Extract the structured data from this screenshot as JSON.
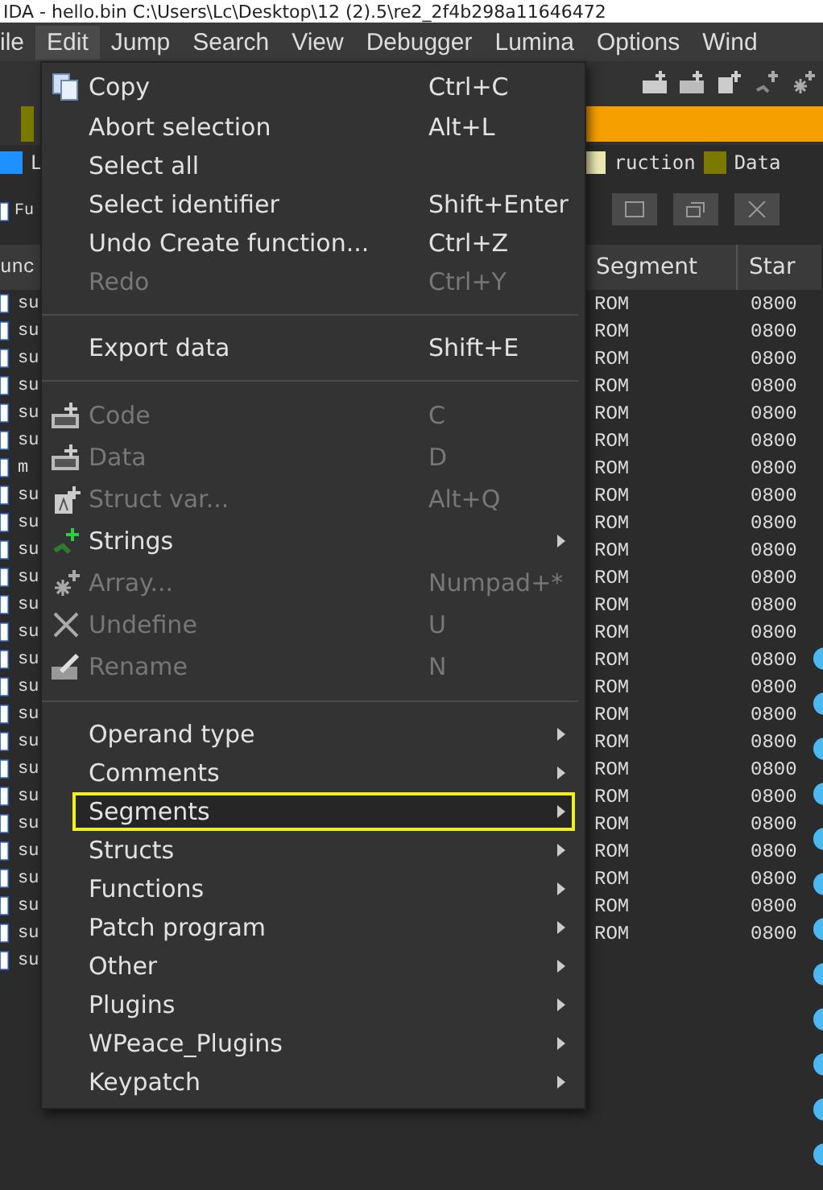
{
  "window": {
    "title": "IDA - hello.bin C:\\Users\\Lc\\Desktop\\12 (2).5\\re2_2f4b298a11646472"
  },
  "menubar": [
    {
      "label": "ile",
      "selected": false
    },
    {
      "label": "Edit",
      "selected": true
    },
    {
      "label": "Jump",
      "selected": false
    },
    {
      "label": "Search",
      "selected": false
    },
    {
      "label": "View",
      "selected": false
    },
    {
      "label": "Debugger",
      "selected": false
    },
    {
      "label": "Lumina",
      "selected": false
    },
    {
      "label": "Options",
      "selected": false
    },
    {
      "label": "Wind",
      "selected": false
    }
  ],
  "legend": [
    {
      "label": "L",
      "color": "#1e90ff"
    },
    {
      "label": "ruction",
      "color": "#e8e8b0"
    },
    {
      "label": "Data",
      "color": "#7a7a00"
    }
  ],
  "functions_panel": {
    "tab": "Fu",
    "column": "unc",
    "rows": [
      "su",
      "su",
      "su",
      "su",
      "su",
      "su",
      "m",
      "su",
      "su",
      "su",
      "su",
      "su",
      "su",
      "su",
      "su",
      "su",
      "su",
      "su",
      "su",
      "su",
      "su",
      "su",
      "su",
      "su",
      "su"
    ]
  },
  "segments_table": {
    "columns": [
      "Segment",
      "Star"
    ],
    "rows": [
      [
        "ROM",
        "0800"
      ],
      [
        "ROM",
        "0800"
      ],
      [
        "ROM",
        "0800"
      ],
      [
        "ROM",
        "0800"
      ],
      [
        "ROM",
        "0800"
      ],
      [
        "ROM",
        "0800"
      ],
      [
        "ROM",
        "0800"
      ],
      [
        "ROM",
        "0800"
      ],
      [
        "ROM",
        "0800"
      ],
      [
        "ROM",
        "0800"
      ],
      [
        "ROM",
        "0800"
      ],
      [
        "ROM",
        "0800"
      ],
      [
        "ROM",
        "0800"
      ],
      [
        "ROM",
        "0800"
      ],
      [
        "ROM",
        "0800"
      ],
      [
        "ROM",
        "0800"
      ],
      [
        "ROM",
        "0800"
      ],
      [
        "ROM",
        "0800"
      ],
      [
        "ROM",
        "0800"
      ],
      [
        "ROM",
        "0800"
      ],
      [
        "ROM",
        "0800"
      ],
      [
        "ROM",
        "0800"
      ],
      [
        "ROM",
        "0800"
      ],
      [
        "ROM",
        "0800"
      ]
    ]
  },
  "edit_menu": [
    {
      "kind": "item",
      "label": "Copy",
      "shortcut": "Ctrl+C",
      "disabled": false,
      "submenu": false,
      "highlighted": false
    },
    {
      "kind": "item",
      "label": "Abort selection",
      "shortcut": "Alt+L",
      "disabled": false,
      "submenu": false,
      "highlighted": false
    },
    {
      "kind": "item",
      "label": "Select all",
      "disabled": false,
      "submenu": false,
      "highlighted": false
    },
    {
      "kind": "item",
      "label": "Select identifier",
      "shortcut": "Shift+Enter",
      "disabled": false,
      "submenu": false,
      "highlighted": false
    },
    {
      "kind": "item",
      "label": "Undo Create function...",
      "shortcut": "Ctrl+Z",
      "disabled": false,
      "submenu": false,
      "highlighted": false
    },
    {
      "kind": "item",
      "label": "Redo",
      "shortcut": "Ctrl+Y",
      "disabled": true,
      "submenu": false,
      "highlighted": false
    },
    {
      "kind": "separator"
    },
    {
      "kind": "item",
      "label": "Export data",
      "shortcut": "Shift+E",
      "disabled": false,
      "submenu": false,
      "highlighted": false
    },
    {
      "kind": "separator"
    },
    {
      "kind": "item",
      "label": "Code",
      "shortcut": "C",
      "disabled": true,
      "submenu": false,
      "highlighted": false
    },
    {
      "kind": "item",
      "label": "Data",
      "shortcut": "D",
      "disabled": true,
      "submenu": false,
      "highlighted": false
    },
    {
      "kind": "item",
      "label": "Struct var...",
      "shortcut": "Alt+Q",
      "disabled": true,
      "submenu": false,
      "highlighted": false
    },
    {
      "kind": "item",
      "label": "Strings",
      "disabled": false,
      "submenu": true,
      "highlighted": false
    },
    {
      "kind": "item",
      "label": "Array...",
      "shortcut": "Numpad+*",
      "disabled": true,
      "submenu": false,
      "highlighted": false
    },
    {
      "kind": "item",
      "label": "Undefine",
      "shortcut": "U",
      "disabled": true,
      "submenu": false,
      "highlighted": false
    },
    {
      "kind": "item",
      "label": "Rename",
      "shortcut": "N",
      "disabled": true,
      "submenu": false,
      "highlighted": false
    },
    {
      "kind": "separator"
    },
    {
      "kind": "item",
      "label": "Operand type",
      "disabled": false,
      "submenu": true,
      "highlighted": false
    },
    {
      "kind": "item",
      "label": "Comments",
      "disabled": false,
      "submenu": true,
      "highlighted": false
    },
    {
      "kind": "item",
      "label": "Segments",
      "disabled": false,
      "submenu": true,
      "highlighted": true
    },
    {
      "kind": "item",
      "label": "Structs",
      "disabled": false,
      "submenu": true,
      "highlighted": false
    },
    {
      "kind": "item",
      "label": "Functions",
      "disabled": false,
      "submenu": true,
      "highlighted": false
    },
    {
      "kind": "item",
      "label": "Patch program",
      "disabled": false,
      "submenu": true,
      "highlighted": false
    },
    {
      "kind": "item",
      "label": "Other",
      "disabled": false,
      "submenu": true,
      "highlighted": false
    },
    {
      "kind": "item",
      "label": "Plugins",
      "disabled": false,
      "submenu": true,
      "highlighted": false
    },
    {
      "kind": "item",
      "label": "WPeace_Plugins",
      "disabled": false,
      "submenu": true,
      "highlighted": false
    },
    {
      "kind": "item",
      "label": "Keypatch",
      "disabled": false,
      "submenu": true,
      "highlighted": false
    }
  ]
}
